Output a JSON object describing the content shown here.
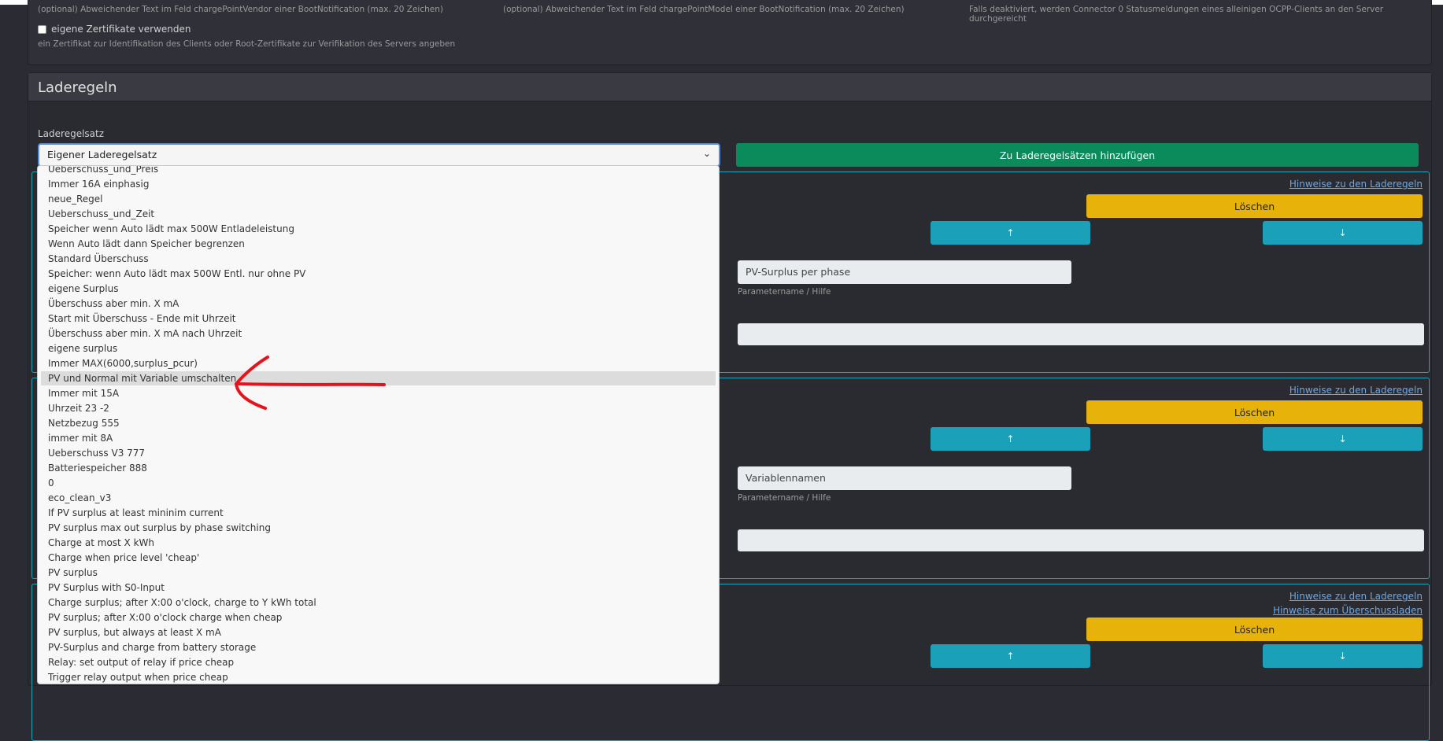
{
  "top": {
    "hint_vendor": "(optional) Abweichender Text im Feld chargePointVendor einer BootNotification (max. 20 Zeichen)",
    "hint_model": "(optional) Abweichender Text im Feld chargePointModel einer BootNotification (max. 20 Zeichen)",
    "hint_connector": "Falls deaktiviert, werden Connector 0 Statusmeldungen eines alleinigen OCPP-Clients an den Server durchgereicht",
    "own_certs_label": "eigene Zertifikate verwenden",
    "own_certs_hint": "ein Zertifikat zur Identifikation des Clients oder Root-Zertifikate zur Verifikation des Servers angeben"
  },
  "section": {
    "title": "Laderegeln",
    "field_label": "Laderegelsatz",
    "selected": "Eigener Laderegelsatz",
    "add_button": "Zu Laderegelsätzen hinzufügen"
  },
  "rules": [
    {
      "link": "Hinweise zu den Laderegeln",
      "delete": "Löschen",
      "up": "↑",
      "down": "↓",
      "param_value": "PV-Surplus per phase",
      "param_help": "Parametername / Hilfe"
    },
    {
      "link": "Hinweise zu den Laderegeln",
      "delete": "Löschen",
      "up": "↑",
      "down": "↓",
      "param_value": "Variablennamen",
      "param_help": "Parametername / Hilfe"
    },
    {
      "link": "Hinweise zu den Laderegeln",
      "link2": "Hinweise zum Überschussladen",
      "delete": "Löschen",
      "up": "↑",
      "down": "↓"
    }
  ],
  "dropdown": {
    "highlighted_index": 14,
    "items": [
      "Ueberschuss_und_Preis",
      "Immer 16A einphasig",
      "neue_Regel",
      "Ueberschuss_und_Zeit",
      "Speicher wenn Auto lädt max 500W Entladeleistung",
      "Wenn Auto lädt dann Speicher begrenzen",
      "Standard Überschuss",
      "Speicher: wenn Auto lädt max 500W Entl. nur ohne PV",
      "eigene Surplus",
      "Überschuss aber min. X mA",
      "Start mit Überschuss - Ende mit Uhrzeit",
      "Überschuss aber min. X mA nach Uhrzeit",
      "eigene surplus",
      "Immer MAX(6000,surplus_pcur)",
      "PV und Normal mit Variable umschalten",
      "Immer mit 15A",
      "Uhrzeit 23 -2",
      "Netzbezug 555",
      "immer mit 8A",
      "Ueberschuss V3 777",
      "Batteriespeicher 888",
      "0",
      "eco_clean_v3",
      "If PV surplus at least mininim current",
      "PV surplus max out surplus by phase switching",
      "Charge at most X kWh",
      "Charge when price level 'cheap'",
      "PV surplus",
      "PV Surplus with S0-Input",
      "Charge surplus; after X:00 o'clock, charge to Y kWh total",
      "PV surplus; after X:00 o'clock charge when cheap",
      "PV surplus, but always at least X mA",
      "PV-Surplus and charge from battery storage",
      "Relay: set output of relay if price cheap",
      "Trigger relay output when price cheap"
    ]
  },
  "colors": {
    "accent_green": "#0b8a5b",
    "accent_yellow": "#e7b30a",
    "accent_teal": "#1aa0b9",
    "annotation": "#e8121c"
  }
}
